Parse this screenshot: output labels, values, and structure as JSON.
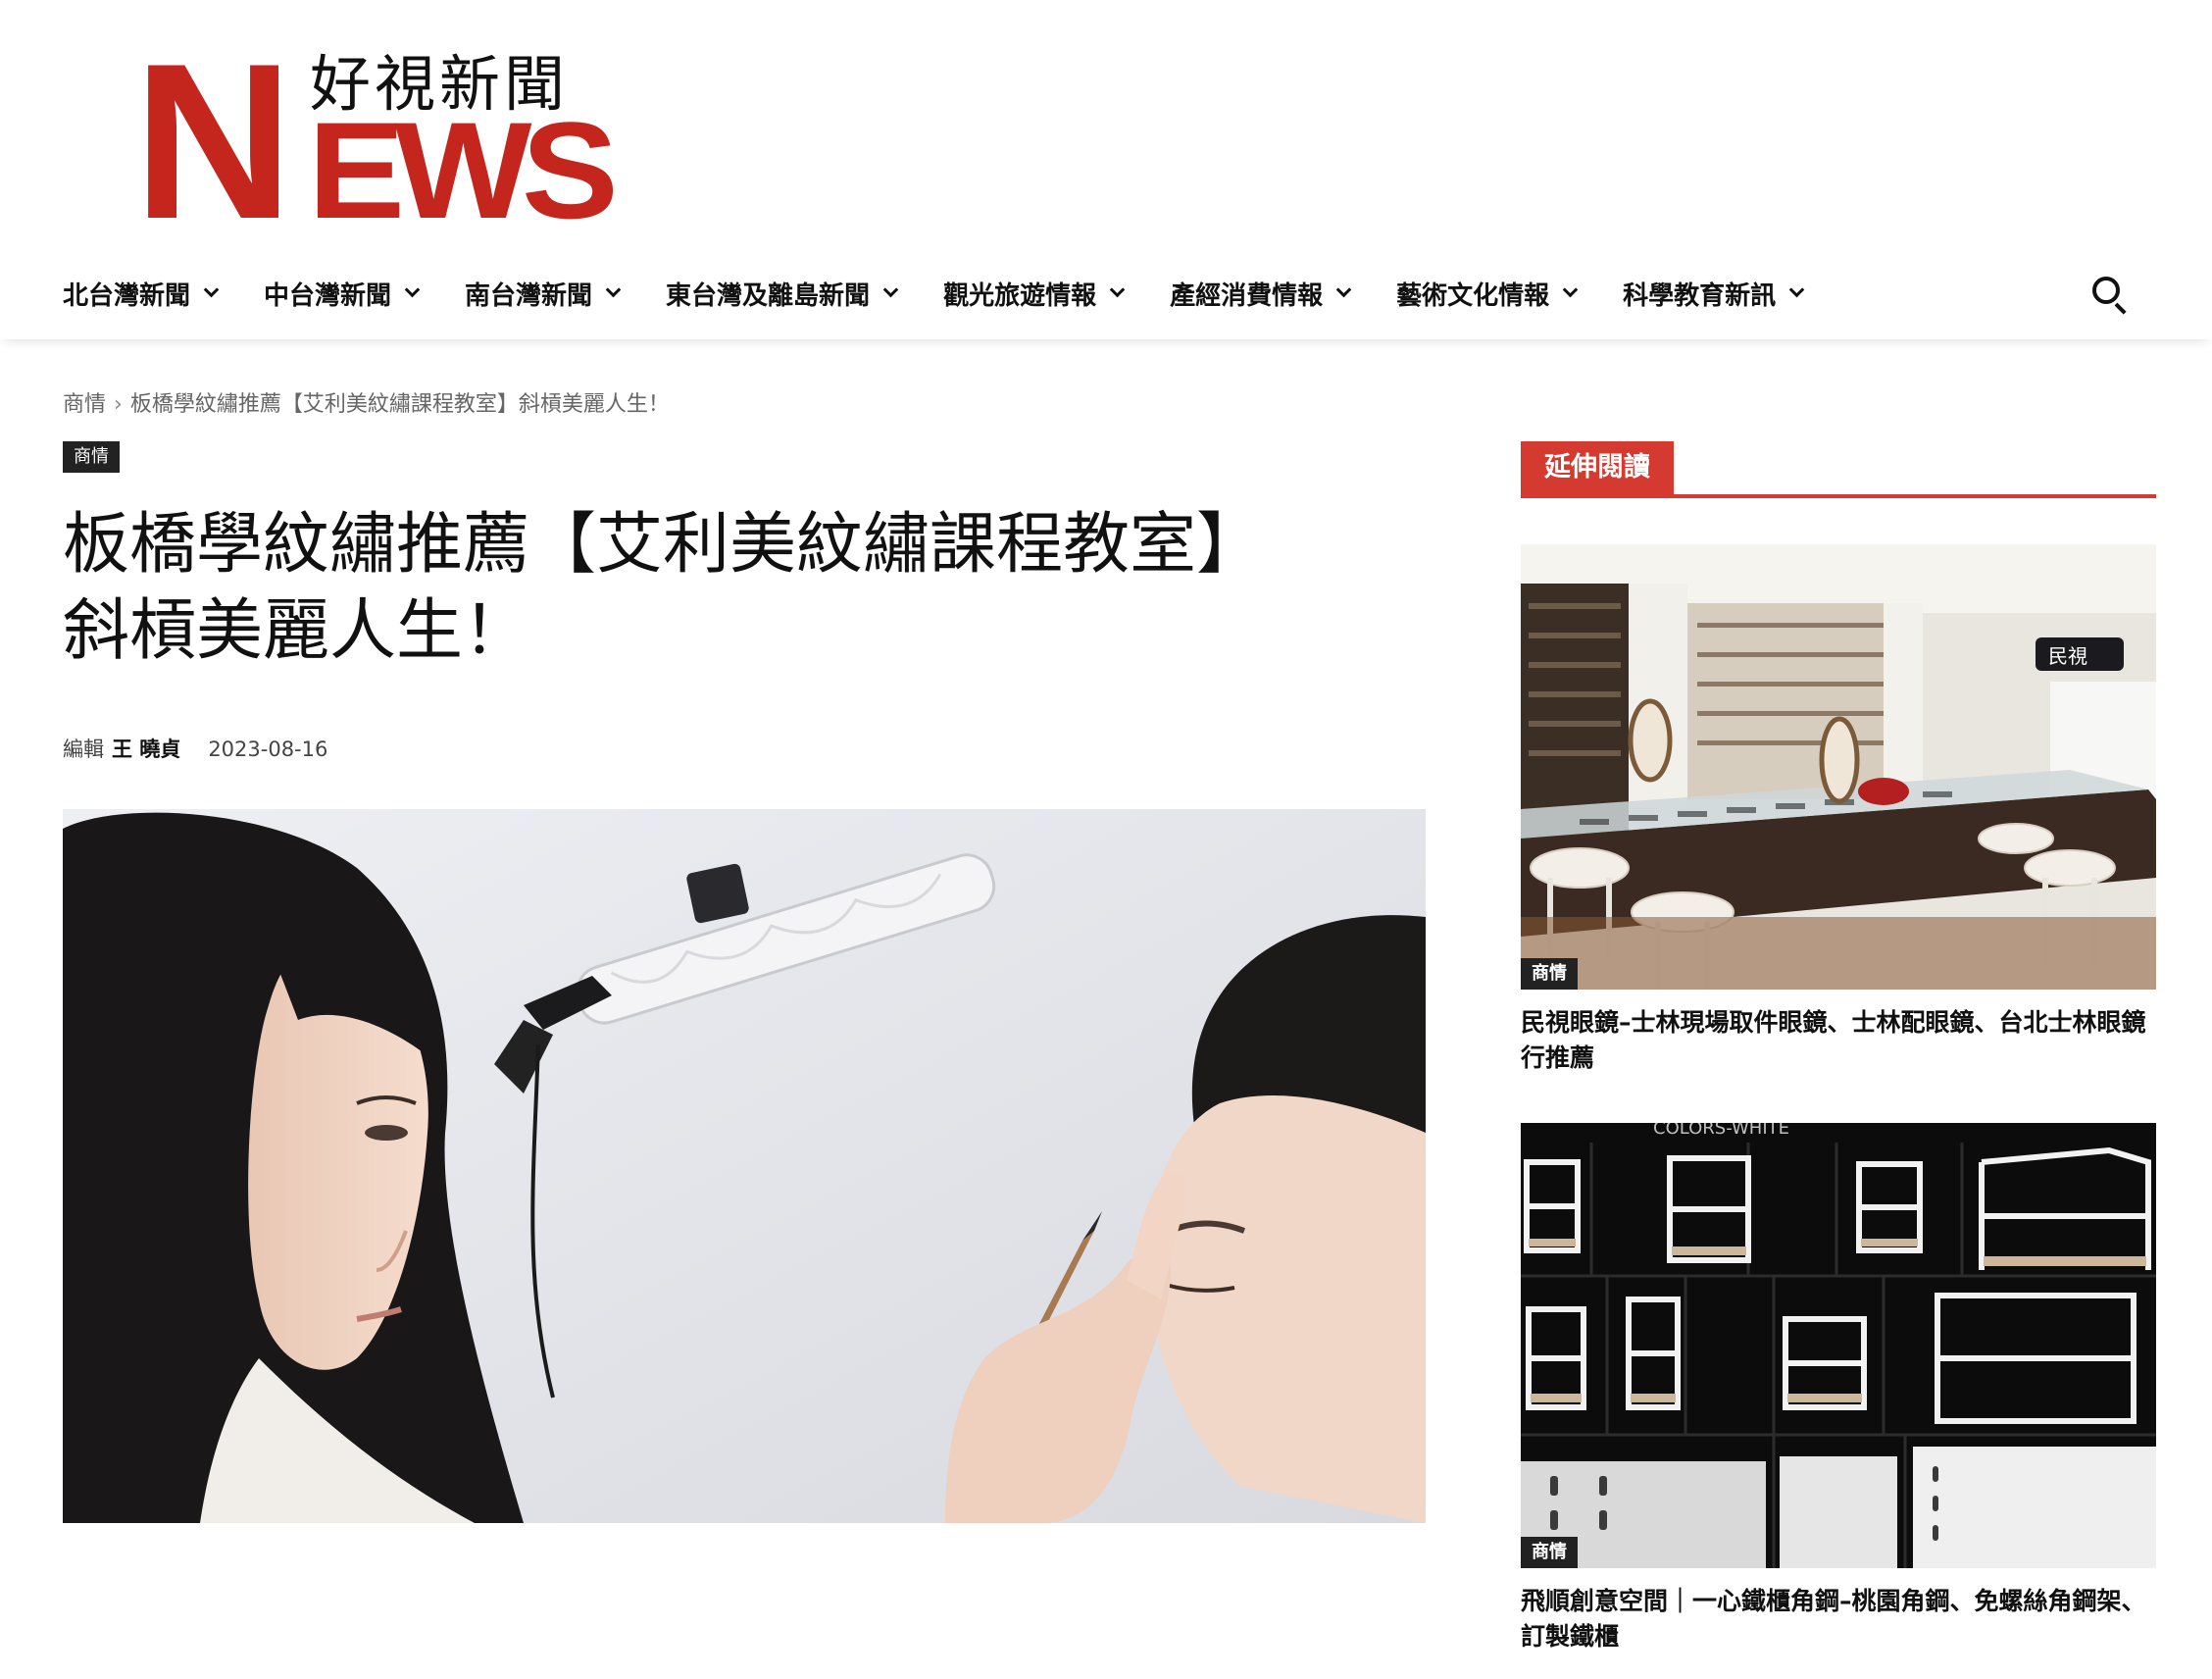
{
  "logo": {
    "letter": "N",
    "rest": "EWS",
    "chinese": "好視新聞"
  },
  "nav": {
    "items": [
      {
        "label": "北台灣新聞"
      },
      {
        "label": "中台灣新聞"
      },
      {
        "label": "南台灣新聞"
      },
      {
        "label": "東台灣及離島新聞"
      },
      {
        "label": "觀光旅遊情報"
      },
      {
        "label": "產經消費情報"
      },
      {
        "label": "藝術文化情報"
      },
      {
        "label": "科學教育新訊"
      }
    ],
    "search_icon": "search-icon"
  },
  "breadcrumb": {
    "items": [
      "商情",
      "板橋學紋繡推薦【艾利美紋繡課程教室】斜槓美麗人生！"
    ],
    "separator": "›"
  },
  "article": {
    "category": "商情",
    "title_line1": "板橋學紋繡推薦【艾利美紋繡課程教室】",
    "title_line2": "斜槓美麗人生！",
    "by_label": "編輯",
    "author": "王 曉貞",
    "date": "2023-08-16"
  },
  "sidebar": {
    "heading": "延伸閱讀",
    "accent_color": "#d43a30",
    "cards": [
      {
        "badge": "商情",
        "title": "民視眼鏡–士林現場取件眼鏡、士林配眼鏡、台北士林眼鏡行推薦",
        "sign_text": "民視"
      },
      {
        "badge": "商情",
        "title": "飛順創意空間｜一心鐵櫃角鋼–桃園角鋼、免螺絲角鋼架、訂製鐵櫃",
        "image_caption": "COLORS-WHITE"
      }
    ]
  },
  "colors": {
    "brand_red": "#c4261d",
    "badge_bg": "#222222"
  }
}
